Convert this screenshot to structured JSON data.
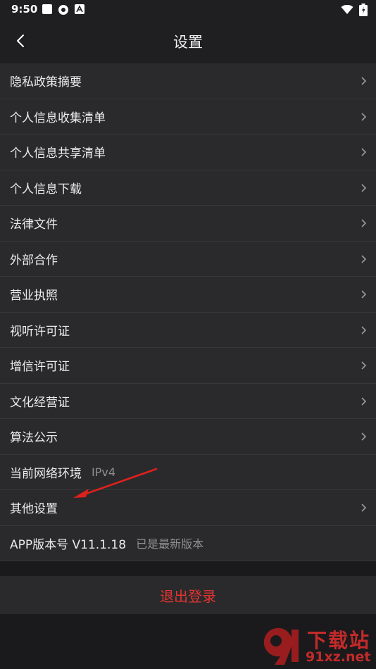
{
  "status_bar": {
    "time": "9:50"
  },
  "header": {
    "title": "设置"
  },
  "menu": [
    {
      "label": "隐私政策摘要",
      "value": "",
      "chevron": true
    },
    {
      "label": "个人信息收集清单",
      "value": "",
      "chevron": true
    },
    {
      "label": "个人信息共享清单",
      "value": "",
      "chevron": true
    },
    {
      "label": "个人信息下载",
      "value": "",
      "chevron": true
    },
    {
      "label": "法律文件",
      "value": "",
      "chevron": true
    },
    {
      "label": "外部合作",
      "value": "",
      "chevron": true
    },
    {
      "label": "营业执照",
      "value": "",
      "chevron": true
    },
    {
      "label": "视听许可证",
      "value": "",
      "chevron": true
    },
    {
      "label": "增信许可证",
      "value": "",
      "chevron": true
    },
    {
      "label": "文化经营证",
      "value": "",
      "chevron": true
    },
    {
      "label": "算法公示",
      "value": "",
      "chevron": true
    },
    {
      "label": "当前网络环境",
      "value": "IPv4",
      "chevron": false
    },
    {
      "label": "其他设置",
      "value": "",
      "chevron": true
    },
    {
      "label": "APP版本号 V11.1.18",
      "value": "已是最新版本",
      "chevron": false
    }
  ],
  "logout": {
    "label": "退出登录"
  },
  "watermark": {
    "text": "下载站",
    "site": "91xz.net"
  },
  "colors": {
    "accent": "#e3342f",
    "background": "#1a1a1c",
    "row_bg": "#2a2a2c"
  }
}
